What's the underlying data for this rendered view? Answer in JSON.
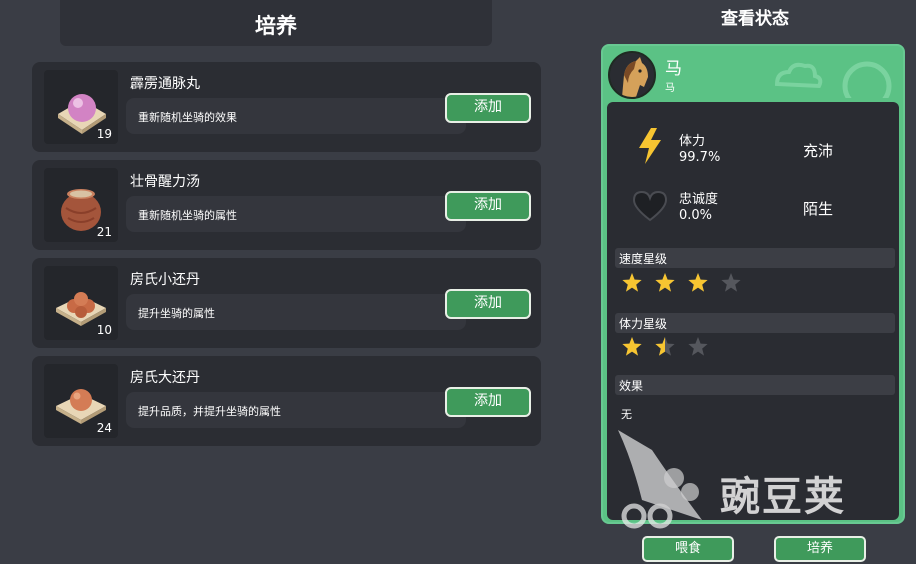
{
  "left_panel": {
    "title": "培养",
    "items": [
      {
        "name": "霹雳通脉丸",
        "description": "重新随机坐骑的效果",
        "count": "19",
        "add_label": "添加",
        "icon": "pink-pill-icon"
      },
      {
        "name": "壮骨醒力汤",
        "description": "重新随机坐骑的属性",
        "count": "21",
        "add_label": "添加",
        "icon": "clay-pot-icon"
      },
      {
        "name": "房氏小还丹",
        "description": "提升坐骑的属性",
        "count": "10",
        "add_label": "添加",
        "icon": "small-pills-icon"
      },
      {
        "name": "房氏大还丹",
        "description": "提升品质，并提升坐骑的属性",
        "count": "24",
        "add_label": "添加",
        "icon": "large-pill-icon"
      }
    ]
  },
  "right_panel": {
    "title": "查看状态",
    "mount": {
      "name": "马",
      "type": "马"
    },
    "stamina": {
      "label": "体力",
      "value": "99.7%",
      "status": "充沛"
    },
    "loyalty": {
      "label": "忠诚度",
      "value": "0.0%",
      "status": "陌生"
    },
    "speed_rating": {
      "label": "速度星级",
      "stars": 3,
      "max": 4
    },
    "stamina_rating": {
      "label": "体力星级",
      "stars": 1.5,
      "max": 3
    },
    "effect": {
      "label": "效果",
      "value": "无"
    }
  },
  "buttons": {
    "feed": "喂食",
    "train": "培养"
  },
  "watermark": {
    "text": "豌豆荚"
  },
  "colors": {
    "background": "#3a3d45",
    "card": "#2b2d33",
    "accent_green": "#3f9a5b",
    "status_green": "#5bc285",
    "star_gold": "#f7c531",
    "star_empty": "#55575d"
  }
}
